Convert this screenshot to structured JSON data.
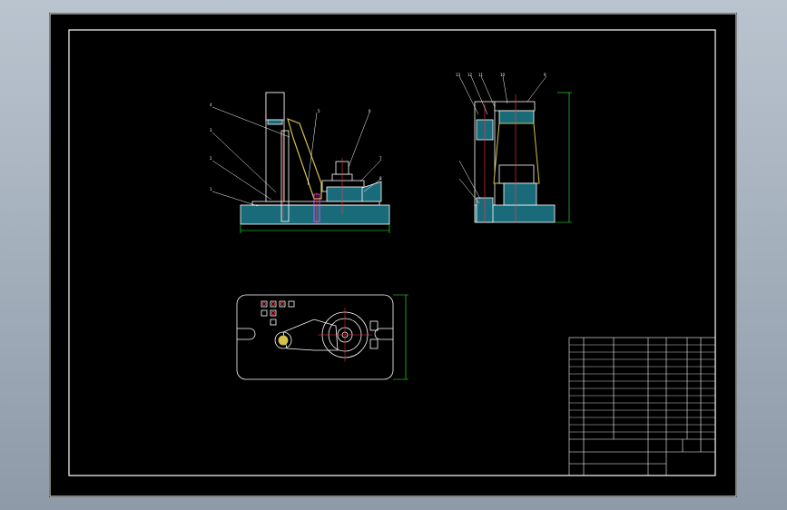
{
  "drawing": {
    "part_callouts": {
      "front": [
        "4",
        "3",
        "2",
        "1",
        "5",
        "6",
        "7",
        "8"
      ],
      "side": [
        "13",
        "12",
        "11",
        "10",
        "9"
      ]
    },
    "notes": {
      "title": "",
      "lines": []
    },
    "title_block": {
      "rows": []
    }
  },
  "colors": {
    "background": "#000000",
    "frame": "#ffffff",
    "part": "#ffffff",
    "section_fill": "#1a6b7a",
    "centerline": "#ff3344",
    "dimension": "#33ff33",
    "hatch_yellow": "#d4c24a",
    "accent_magenta": "#ff44ff"
  }
}
